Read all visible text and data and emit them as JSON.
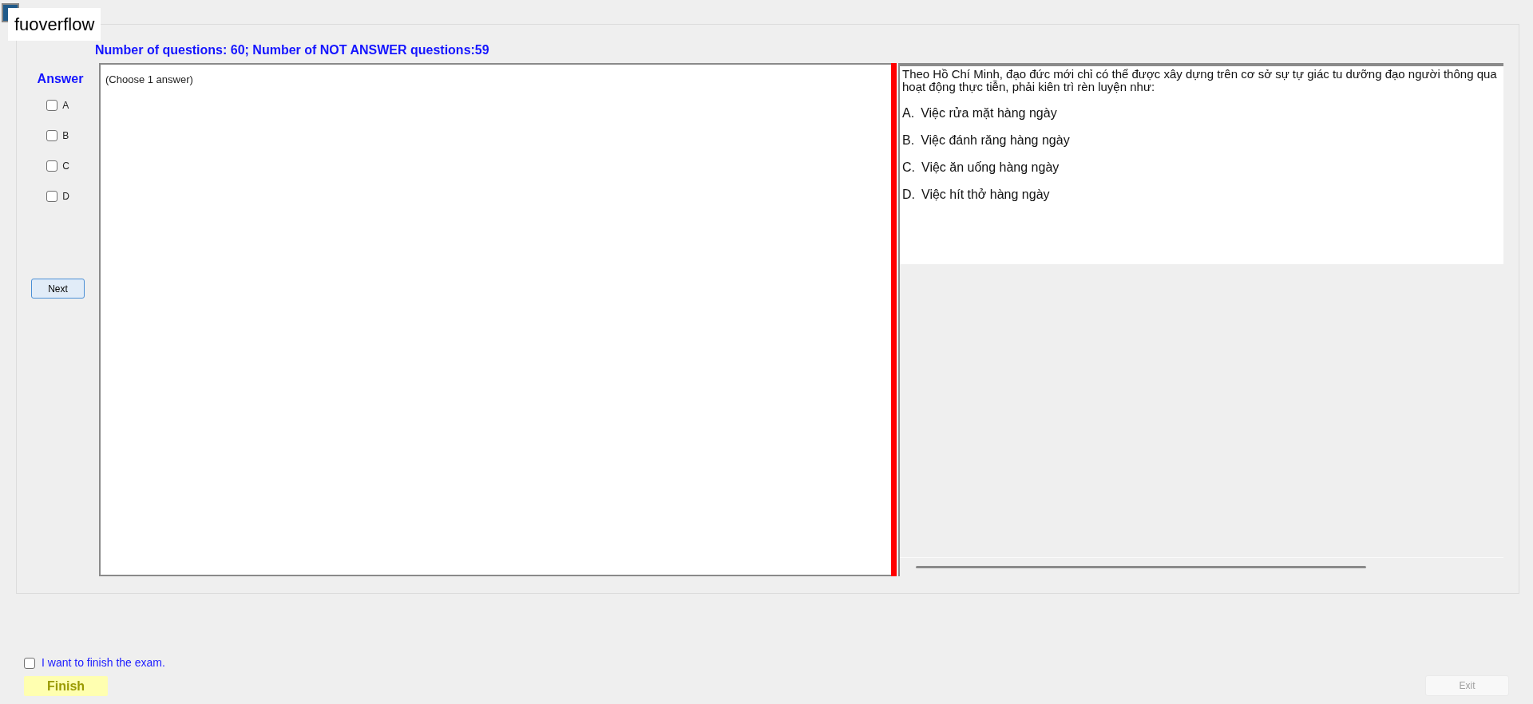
{
  "window": {
    "title": "fuoverflow"
  },
  "summary": "Number of questions: 60; Number of NOT ANSWER questions:59",
  "answer_panel": {
    "title": "Answer",
    "options": [
      {
        "label": "A",
        "checked": false
      },
      {
        "label": "B",
        "checked": false
      },
      {
        "label": "C",
        "checked": false
      },
      {
        "label": "D",
        "checked": false
      }
    ],
    "next_button": "Next"
  },
  "answer_box": {
    "hint": "(Choose 1 answer)"
  },
  "question": {
    "text": "Theo Hồ Chí Minh, đạo đức mới chỉ có thể được xây dựng trên cơ sở sự tự giác tu dưỡng đạo người thông qua hoạt động thực tiễn, phải kiên trì rèn luyện như:",
    "choices": [
      {
        "letter": "A.",
        "text": "Việc rửa mặt hàng ngày"
      },
      {
        "letter": "B.",
        "text": "Việc đánh răng hàng ngày"
      },
      {
        "letter": "C.",
        "text": "Việc ăn uống hàng ngày"
      },
      {
        "letter": "D.",
        "text": "Việc hít thở hàng ngày"
      }
    ]
  },
  "finish_confirm": {
    "label": "I want to finish the exam.",
    "checked": false
  },
  "finish_button": {
    "label": "Finish",
    "disabled": false
  },
  "exit_button": {
    "label": "Exit",
    "disabled": true
  }
}
